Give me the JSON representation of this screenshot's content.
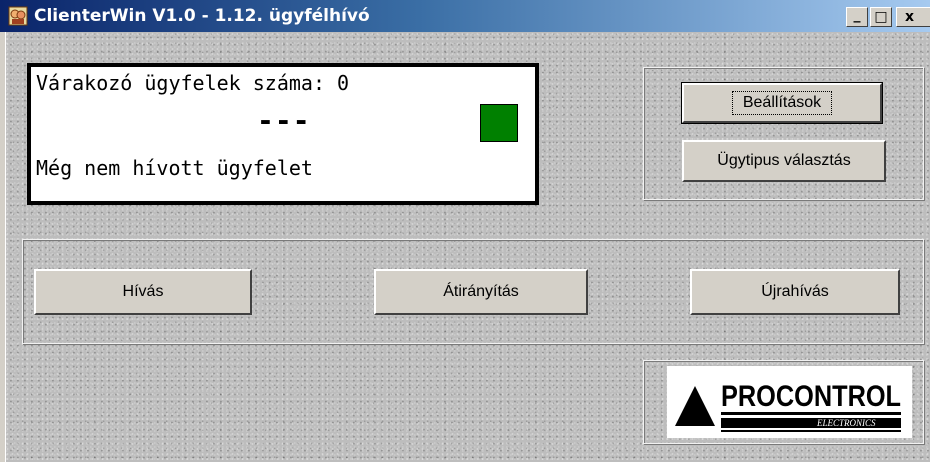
{
  "window": {
    "title": "ClienterWin V1.0 - 1.12. ügyfélhívó",
    "app_icon": "client-app-icon",
    "controls": {
      "minimize": "_",
      "maximize": "□",
      "close": "x"
    },
    "titlebar_colors": [
      "#0a246a",
      "#a6caf0"
    ]
  },
  "display": {
    "queue_label": "Várakozó ügyfelek száma: 0",
    "current_number": "---",
    "status_message": "Még nem hívott ügyfelet",
    "status_light_color": "#008000"
  },
  "settings_group": {
    "settings_button": "Beállítások",
    "ticket_type_button": "Ügytipus választás"
  },
  "actions": {
    "call_button": "Hívás",
    "redirect_button": "Átirányítás",
    "recall_button": "Újrahívás"
  },
  "logo": {
    "brand": "PROCONTROL",
    "sub": "ELECTRONICS"
  }
}
